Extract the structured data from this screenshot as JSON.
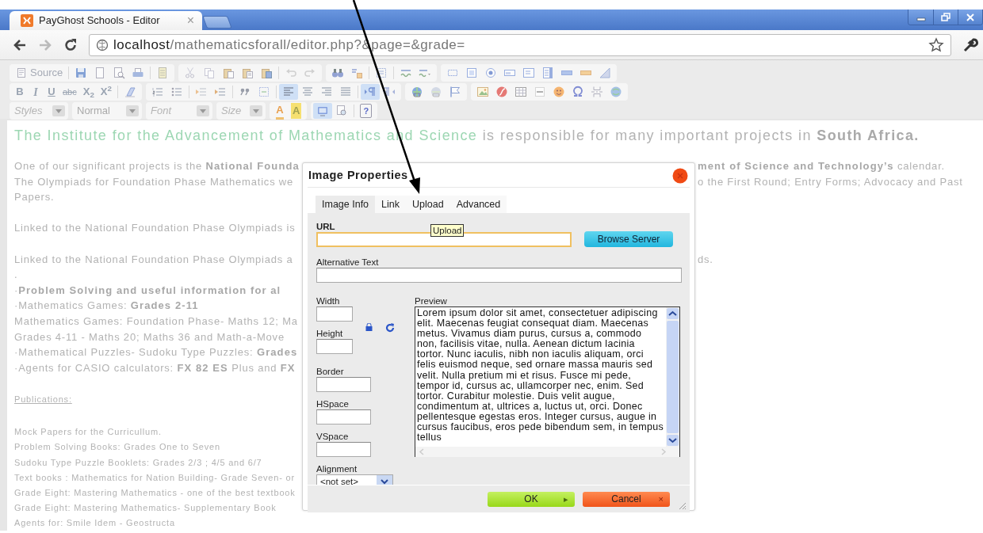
{
  "browser": {
    "tab_title": "PayGhost Schools - Editor",
    "tab_close": "×",
    "url_host": "localhost",
    "url_path": "/mathematicsforall/editor.php?&page=&grade="
  },
  "toolbar": {
    "rows": [
      [
        [
          [
            {
              "kind": "text-icon",
              "label": "Source",
              "on": false
            }
          ],
          [
            {
              "kind": "icon",
              "on": false
            },
            {
              "kind": "icon",
              "on": false
            },
            {
              "kind": "icon",
              "on": false
            },
            {
              "kind": "icon",
              "on": false
            }
          ],
          [
            {
              "kind": "icon",
              "on": false
            }
          ]
        ],
        [
          [
            {
              "kind": "icon",
              "on": false
            },
            {
              "kind": "icon",
              "on": false
            },
            {
              "kind": "icon",
              "on": false
            },
            {
              "kind": "icon",
              "on": false
            },
            {
              "kind": "icon",
              "on": false
            }
          ],
          [
            {
              "kind": "icon",
              "on": false
            },
            {
              "kind": "icon",
              "on": false
            }
          ]
        ],
        [
          [
            {
              "kind": "icon",
              "on": false
            },
            {
              "kind": "icon",
              "on": false
            }
          ],
          [
            {
              "kind": "icon",
              "on": false
            }
          ],
          [
            {
              "kind": "icon",
              "on": false
            },
            {
              "kind": "icon",
              "on": false
            }
          ]
        ],
        [
          [
            {
              "kind": "icon",
              "on": false
            },
            {
              "kind": "icon",
              "on": false
            },
            {
              "kind": "icon",
              "on": false
            },
            {
              "kind": "icon",
              "on": false
            },
            {
              "kind": "icon",
              "on": false
            },
            {
              "kind": "icon",
              "on": false
            },
            {
              "kind": "icon",
              "on": false
            },
            {
              "kind": "icon",
              "on": false
            },
            {
              "kind": "icon",
              "on": false
            }
          ]
        ]
      ],
      [
        [
          [
            {
              "kind": "glyph",
              "label": "B",
              "on": false
            },
            {
              "kind": "glyph",
              "label": "I",
              "on": false
            },
            {
              "kind": "glyph",
              "label": "U",
              "on": false
            },
            {
              "kind": "glyph",
              "label": "abc",
              "on": false
            },
            {
              "kind": "glyph",
              "label": "X$_{2}$",
              "on": false
            },
            {
              "kind": "glyph",
              "label": "X$^{2}$",
              "on": false
            }
          ],
          [
            {
              "kind": "icon",
              "on": false
            }
          ]
        ],
        [
          [
            {
              "kind": "icon",
              "on": false
            },
            {
              "kind": "icon",
              "on": false
            }
          ],
          [
            {
              "kind": "icon",
              "on": false
            },
            {
              "kind": "icon",
              "on": false
            }
          ],
          [
            {
              "kind": "icon",
              "on": false
            },
            {
              "kind": "icon",
              "on": false
            }
          ],
          [
            {
              "kind": "icon",
              "on": true
            },
            {
              "kind": "icon",
              "on": false
            },
            {
              "kind": "icon",
              "on": false
            },
            {
              "kind": "icon",
              "on": false
            }
          ],
          [
            {
              "kind": "icon",
              "on": true
            },
            {
              "kind": "icon",
              "on": false
            }
          ]
        ],
        [
          [
            {
              "kind": "icon",
              "on": false
            },
            {
              "kind": "icon",
              "on": false
            },
            {
              "kind": "icon",
              "on": false
            }
          ]
        ],
        [
          [
            {
              "kind": "icon",
              "on": false
            },
            {
              "kind": "icon",
              "on": false
            },
            {
              "kind": "icon",
              "on": false
            },
            {
              "kind": "icon",
              "on": false
            },
            {
              "kind": "icon",
              "on": false
            },
            {
              "kind": "icon",
              "on": false
            },
            {
              "kind": "icon",
              "on": false
            },
            {
              "kind": "icon",
              "on": false
            }
          ]
        ]
      ],
      [
        [
          [
            {
              "kind": "combo",
              "placeholder": "Styles"
            }
          ]
        ],
        [
          [
            {
              "kind": "combo",
              "value": "Normal"
            }
          ]
        ],
        [
          [
            {
              "kind": "combo",
              "placeholder": "Font"
            }
          ]
        ],
        [
          [
            {
              "kind": "combo",
              "placeholder": "Size"
            }
          ]
        ],
        [
          [
            {
              "kind": "glyph",
              "label": "A",
              "on": false
            },
            {
              "kind": "glyph",
              "label": "A",
              "on": false
            }
          ]
        ],
        [
          [
            {
              "kind": "icon",
              "on": true
            },
            {
              "kind": "icon",
              "on": false
            }
          ],
          [
            {
              "kind": "glyph",
              "label": "?",
              "on": false
            }
          ]
        ]
      ]
    ]
  },
  "document": {
    "heading": [
      {
        "kind": "highlight",
        "text": "The Institute for the Advancement of Mathematics and Science"
      },
      {
        "kind": "plain",
        "text": " is responsible for many important projects in "
      },
      {
        "kind": "bold",
        "text": "South Africa."
      }
    ],
    "paragraphs": [
      [
        {
          "left": "One of our significant projects is the **National Founda**",
          "right": "**ment of Science and Technology’s** calendar."
        },
        {
          "left": "The Olympiads for Foundation Phase Mathematics we",
          "right": "o the First Round; Entry Forms; Advocacy and Past"
        },
        {
          "left": "Papers."
        }
      ],
      [
        {
          "left": "Linked to the National Foundation Phase Olympiads is"
        }
      ],
      [
        {
          "left": "Linked to the National Foundation Phase Olympiads a",
          "right": "ds."
        },
        {
          "left": "."
        },
        {
          "left": "·**Problem Solving and useful information for al**"
        },
        {
          "left": "·Mathematics Games: **Grades 2-11**"
        },
        {
          "left": "Mathematics Games: Foundation Phase- Maths 12; Ma"
        },
        {
          "left": "Grades 4-11 - Maths 20; Maths 36 and Math-a-Move"
        },
        {
          "left": "·Mathematical Puzzles- Sudoku Type Puzzles: **Grades**"
        },
        {
          "left": "·Agents for CASIO calculators: **FX 82 ES** Plus and **FX**"
        }
      ]
    ],
    "publications_heading": "Publications:",
    "publications": [
      "Mock Papers for the Curricullum.",
      "Problem Solving Books: Grades One to Seven",
      "Sudoku Type Puzzle Booklets: Grades 2/3 ; 4/5 and 6/7",
      "Text books : Mathematics for Nation Building- Grade Seven- or",
      "Grade Eight: Mastering Mathematics - one of the best textbook",
      "Grade Eight: Mastering Mathematics- Supplementary Book",
      "Agents for: Smile Idem - Geostructa"
    ]
  },
  "dialog": {
    "title": "Image Properties",
    "tabs": [
      {
        "label": "Image Info",
        "selected": true
      },
      {
        "label": "Link",
        "selected": false
      },
      {
        "label": "Upload",
        "selected": false
      },
      {
        "label": "Advanced",
        "selected": false
      }
    ],
    "tooltip": "Upload",
    "url": {
      "label": "URL",
      "focused": true
    },
    "browse_button": "Browse Server",
    "alt_text": {
      "label": "Alternative Text",
      "focused": false
    },
    "size_fields": [
      "Width",
      "Height"
    ],
    "spacing_fields": [
      "Border",
      "HSpace",
      "VSpace"
    ],
    "alignment": {
      "label": "Alignment",
      "value": "<not set>"
    },
    "preview": {
      "label": "Preview",
      "text": "Lorem ipsum dolor sit amet, consectetuer adipiscing elit. Maecenas feugiat consequat diam. Maecenas metus. Vivamus diam purus, cursus a, commodo non, facilisis vitae, nulla. Aenean dictum lacinia tortor. Nunc iaculis, nibh non iaculis aliquam, orci felis euismod neque, sed ornare massa mauris sed velit. Nulla pretium mi et risus. Fusce mi pede, tempor id, cursus ac, ullamcorper nec, enim. Sed tortor. Curabitur molestie. Duis velit augue, condimentum at, ultrices a, luctus ut, orci. Donec pellentesque egestas eros. Integer cursus, augue in cursus faucibus, eros pede bibendum sem, in tempus tellus"
    },
    "buttons": [
      {
        "kind": "ok",
        "label": "OK",
        "icon": "▸"
      },
      {
        "kind": "cancel",
        "label": "Cancel",
        "icon": "×"
      }
    ]
  }
}
